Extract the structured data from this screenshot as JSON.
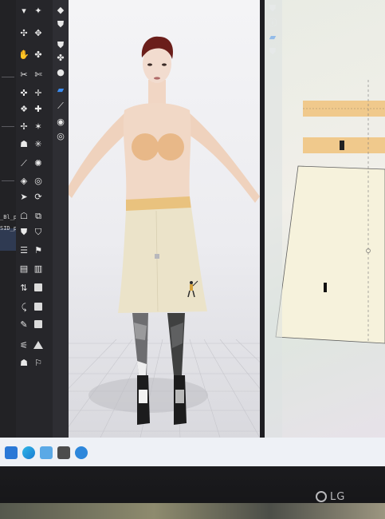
{
  "left_panel": {
    "files": [
      "_Bl_p",
      "SID_p"
    ]
  },
  "viewport_3d": {
    "grid": true
  },
  "pattern_window": {
    "right_icons": [
      "shirt-icon",
      "info-icon",
      "marker-icon",
      "shirt-icon"
    ]
  },
  "taskbar": {
    "apps": [
      "windows-start-icon",
      "edge-icon",
      "image-viewer-icon",
      "calculator-icon",
      "app-icon"
    ]
  },
  "monitor": {
    "brand": "LG"
  }
}
